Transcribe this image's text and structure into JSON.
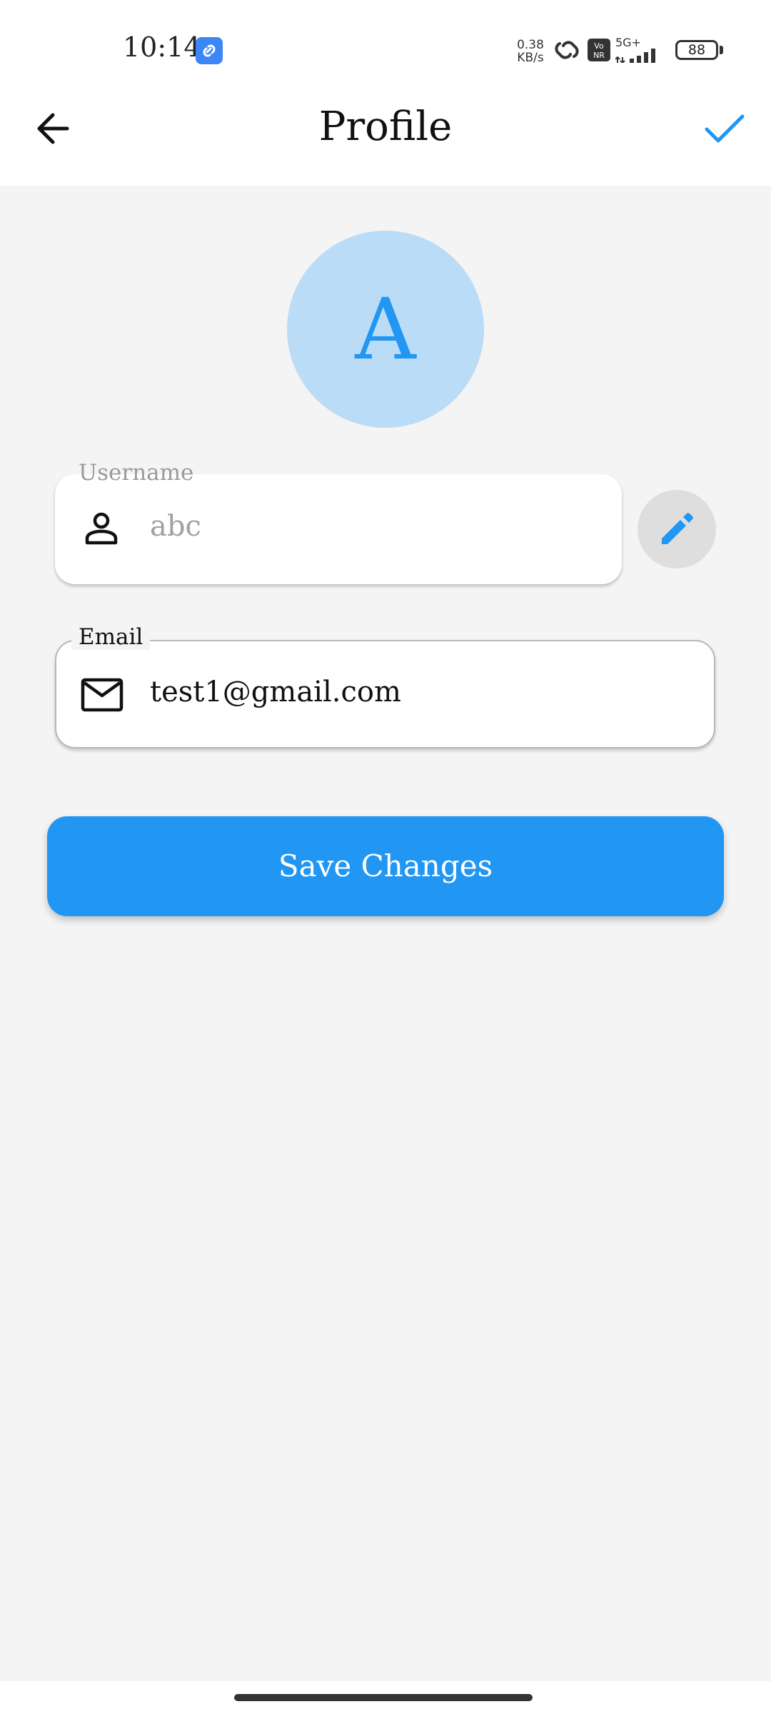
{
  "status_bar": {
    "time": "10:14",
    "net_speed_value": "0.38",
    "net_speed_unit": "KB/s",
    "volte_text": "Vo NR",
    "network_type": "5G+",
    "battery_level": "88",
    "app_notification_icon": "link-icon"
  },
  "app_bar": {
    "title": "Profile",
    "back_icon": "arrow-left-icon",
    "confirm_icon": "check-icon",
    "accent_color": "#2196f3"
  },
  "avatar": {
    "initial": "A",
    "background_color": "#bbdcf7",
    "text_color": "#2196f3"
  },
  "form": {
    "username": {
      "label": "Username",
      "value": "abc",
      "icon": "person-icon",
      "edit_icon": "pencil-icon"
    },
    "email": {
      "label": "Email",
      "value": "test1@gmail.com",
      "icon": "mail-icon"
    }
  },
  "actions": {
    "save_label": "Save Changes",
    "save_color": "#2196f3"
  }
}
